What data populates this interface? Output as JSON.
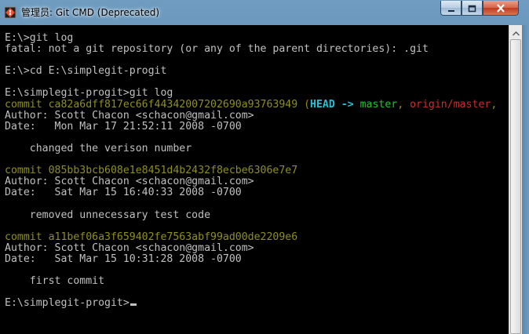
{
  "window": {
    "title": "管理员: Git CMD (Deprecated)",
    "icons": {
      "app": "git-icon",
      "minimize": "minimize-icon",
      "maximize": "maximize-icon",
      "close": "close-icon",
      "scroll_up": "scroll-up-arrow-icon"
    }
  },
  "colors": {
    "background": "#000000",
    "text": "#c0c0c0",
    "commit_hash": "#8f8f1d",
    "head_ref": "#22c3d6",
    "branch": "#22c32c",
    "remote_branch": "#d42a2a"
  },
  "console": {
    "lines": [
      {
        "segments": [
          {
            "text": "E:\\>git log",
            "style": ""
          }
        ]
      },
      {
        "segments": [
          {
            "text": "fatal: not a git repository (or any of the parent directories): .git",
            "style": ""
          }
        ]
      },
      {
        "segments": [
          {
            "text": "",
            "style": ""
          }
        ]
      },
      {
        "segments": [
          {
            "text": "E:\\>cd E:\\simplegit-progit",
            "style": ""
          }
        ]
      },
      {
        "segments": [
          {
            "text": "",
            "style": ""
          }
        ]
      },
      {
        "segments": [
          {
            "text": "E:\\simplegit-progit>git log",
            "style": ""
          }
        ]
      },
      {
        "segments": [
          {
            "text": "commit ca82a6dff817ec66f44342007202690a93763949 (",
            "style": "y"
          },
          {
            "text": "HEAD -> ",
            "style": "c"
          },
          {
            "text": "master",
            "style": "g"
          },
          {
            "text": ", ",
            "style": "y"
          },
          {
            "text": "origin/master",
            "style": "r"
          },
          {
            "text": ",",
            "style": "y"
          }
        ]
      },
      {
        "segments": [
          {
            "text": "Author: Scott Chacon <schacon@gmail.com>",
            "style": ""
          }
        ]
      },
      {
        "segments": [
          {
            "text": "Date:   Mon Mar 17 21:52:11 2008 -0700",
            "style": ""
          }
        ]
      },
      {
        "segments": [
          {
            "text": "",
            "style": ""
          }
        ]
      },
      {
        "segments": [
          {
            "text": "    changed the verison number",
            "style": ""
          }
        ]
      },
      {
        "segments": [
          {
            "text": "",
            "style": ""
          }
        ]
      },
      {
        "segments": [
          {
            "text": "commit 085bb3bcb608e1e8451d4b2432f8ecbe6306e7e7",
            "style": "y"
          }
        ]
      },
      {
        "segments": [
          {
            "text": "Author: Scott Chacon <schacon@gmail.com>",
            "style": ""
          }
        ]
      },
      {
        "segments": [
          {
            "text": "Date:   Sat Mar 15 16:40:33 2008 -0700",
            "style": ""
          }
        ]
      },
      {
        "segments": [
          {
            "text": "",
            "style": ""
          }
        ]
      },
      {
        "segments": [
          {
            "text": "    removed unnecessary test code",
            "style": ""
          }
        ]
      },
      {
        "segments": [
          {
            "text": "",
            "style": ""
          }
        ]
      },
      {
        "segments": [
          {
            "text": "commit a11bef06a3f659402fe7563abf99ad00de2209e6",
            "style": "y"
          }
        ]
      },
      {
        "segments": [
          {
            "text": "Author: Scott Chacon <schacon@gmail.com>",
            "style": ""
          }
        ]
      },
      {
        "segments": [
          {
            "text": "Date:   Sat Mar 15 10:31:28 2008 -0700",
            "style": ""
          }
        ]
      },
      {
        "segments": [
          {
            "text": "",
            "style": ""
          }
        ]
      },
      {
        "segments": [
          {
            "text": "    first commit",
            "style": ""
          }
        ]
      },
      {
        "segments": [
          {
            "text": "",
            "style": ""
          }
        ]
      },
      {
        "segments": [
          {
            "text": "E:\\simplegit-progit>",
            "style": ""
          }
        ],
        "cursor": true
      }
    ]
  }
}
